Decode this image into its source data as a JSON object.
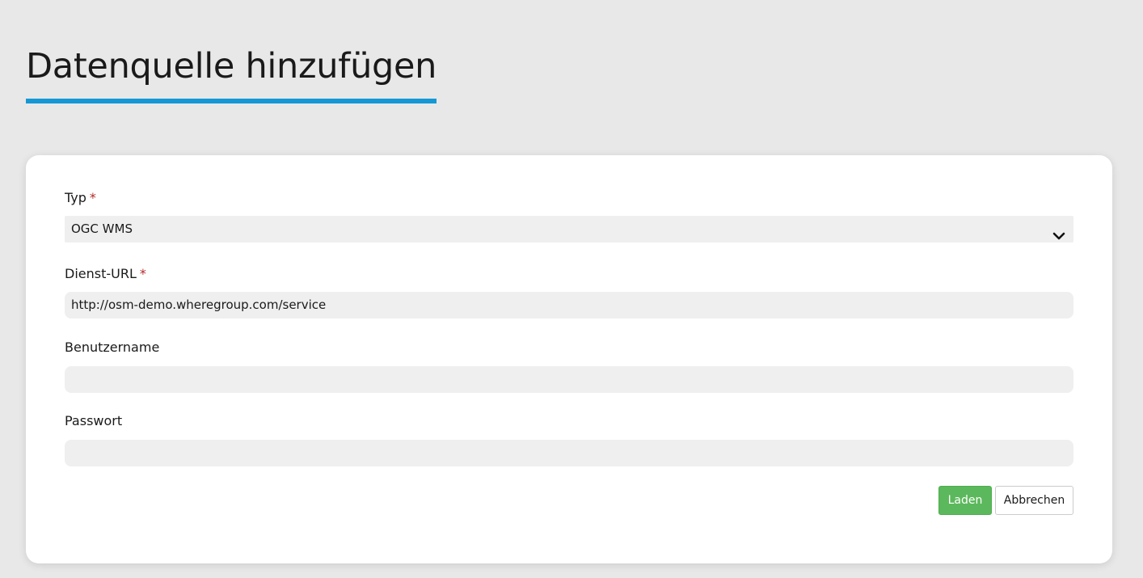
{
  "page": {
    "title": "Datenquelle hinzufügen"
  },
  "form": {
    "type": {
      "label": "Typ",
      "required_mark": "*",
      "selected_value": "OGC WMS",
      "icon": "chevron-down-icon"
    },
    "service_url": {
      "label": "Dienst-URL",
      "required_mark": "*",
      "value": "http://osm-demo.wheregroup.com/service"
    },
    "username": {
      "label": "Benutzername",
      "value": ""
    },
    "password": {
      "label": "Passwort",
      "value": ""
    }
  },
  "actions": {
    "load_label": "Laden",
    "cancel_label": "Abbrechen"
  },
  "colors": {
    "accent": "#1598d6",
    "primary_button": "#5cb85c",
    "required": "#b42828",
    "background": "#e8e8e8"
  }
}
